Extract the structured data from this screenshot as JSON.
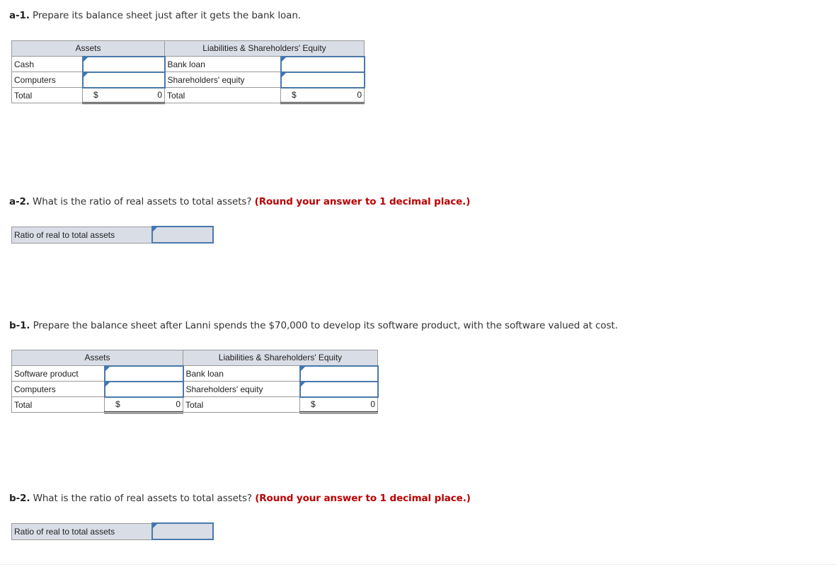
{
  "a1": {
    "label": "a-1.",
    "question": "Prepare its balance sheet just after it gets the bank loan.",
    "table": {
      "assets_header": "Assets",
      "liab_header": "Liabilities & Shareholders' Equity",
      "rows": [
        {
          "asset": "Cash",
          "asset_value": "",
          "liab": "Bank loan",
          "liab_value": ""
        },
        {
          "asset": "Computers",
          "asset_value": "",
          "liab": "Shareholders' equity",
          "liab_value": ""
        }
      ],
      "total": {
        "asset": "Total",
        "asset_currency": "$",
        "asset_value": "0",
        "liab": "Total",
        "liab_currency": "$",
        "liab_value": "0"
      }
    }
  },
  "a2": {
    "label": "a-2.",
    "question": "What is the ratio of real assets to total assets?",
    "hint": "(Round your answer to 1 decimal place.)",
    "ratio_label": "Ratio of real to total assets",
    "ratio_value": ""
  },
  "b1": {
    "label": "b-1.",
    "question": "Prepare the balance sheet after Lanni spends the $70,000 to develop its software product, with the software valued at cost.",
    "table": {
      "assets_header": "Assets",
      "liab_header": "Liabilities & Shareholders' Equity",
      "rows": [
        {
          "asset": "Software product",
          "asset_value": "",
          "liab": "Bank loan",
          "liab_value": ""
        },
        {
          "asset": "Computers",
          "asset_value": "",
          "liab": "Shareholders' equity",
          "liab_value": ""
        }
      ],
      "total": {
        "asset": "Total",
        "asset_currency": "$",
        "asset_value": "0",
        "liab": "Total",
        "liab_currency": "$",
        "liab_value": "0"
      }
    }
  },
  "b2": {
    "label": "b-2.",
    "question": "What is the ratio of real assets to total assets?",
    "hint": "(Round your answer to 1 decimal place.)",
    "ratio_label": "Ratio of real to total assets",
    "ratio_value": ""
  }
}
